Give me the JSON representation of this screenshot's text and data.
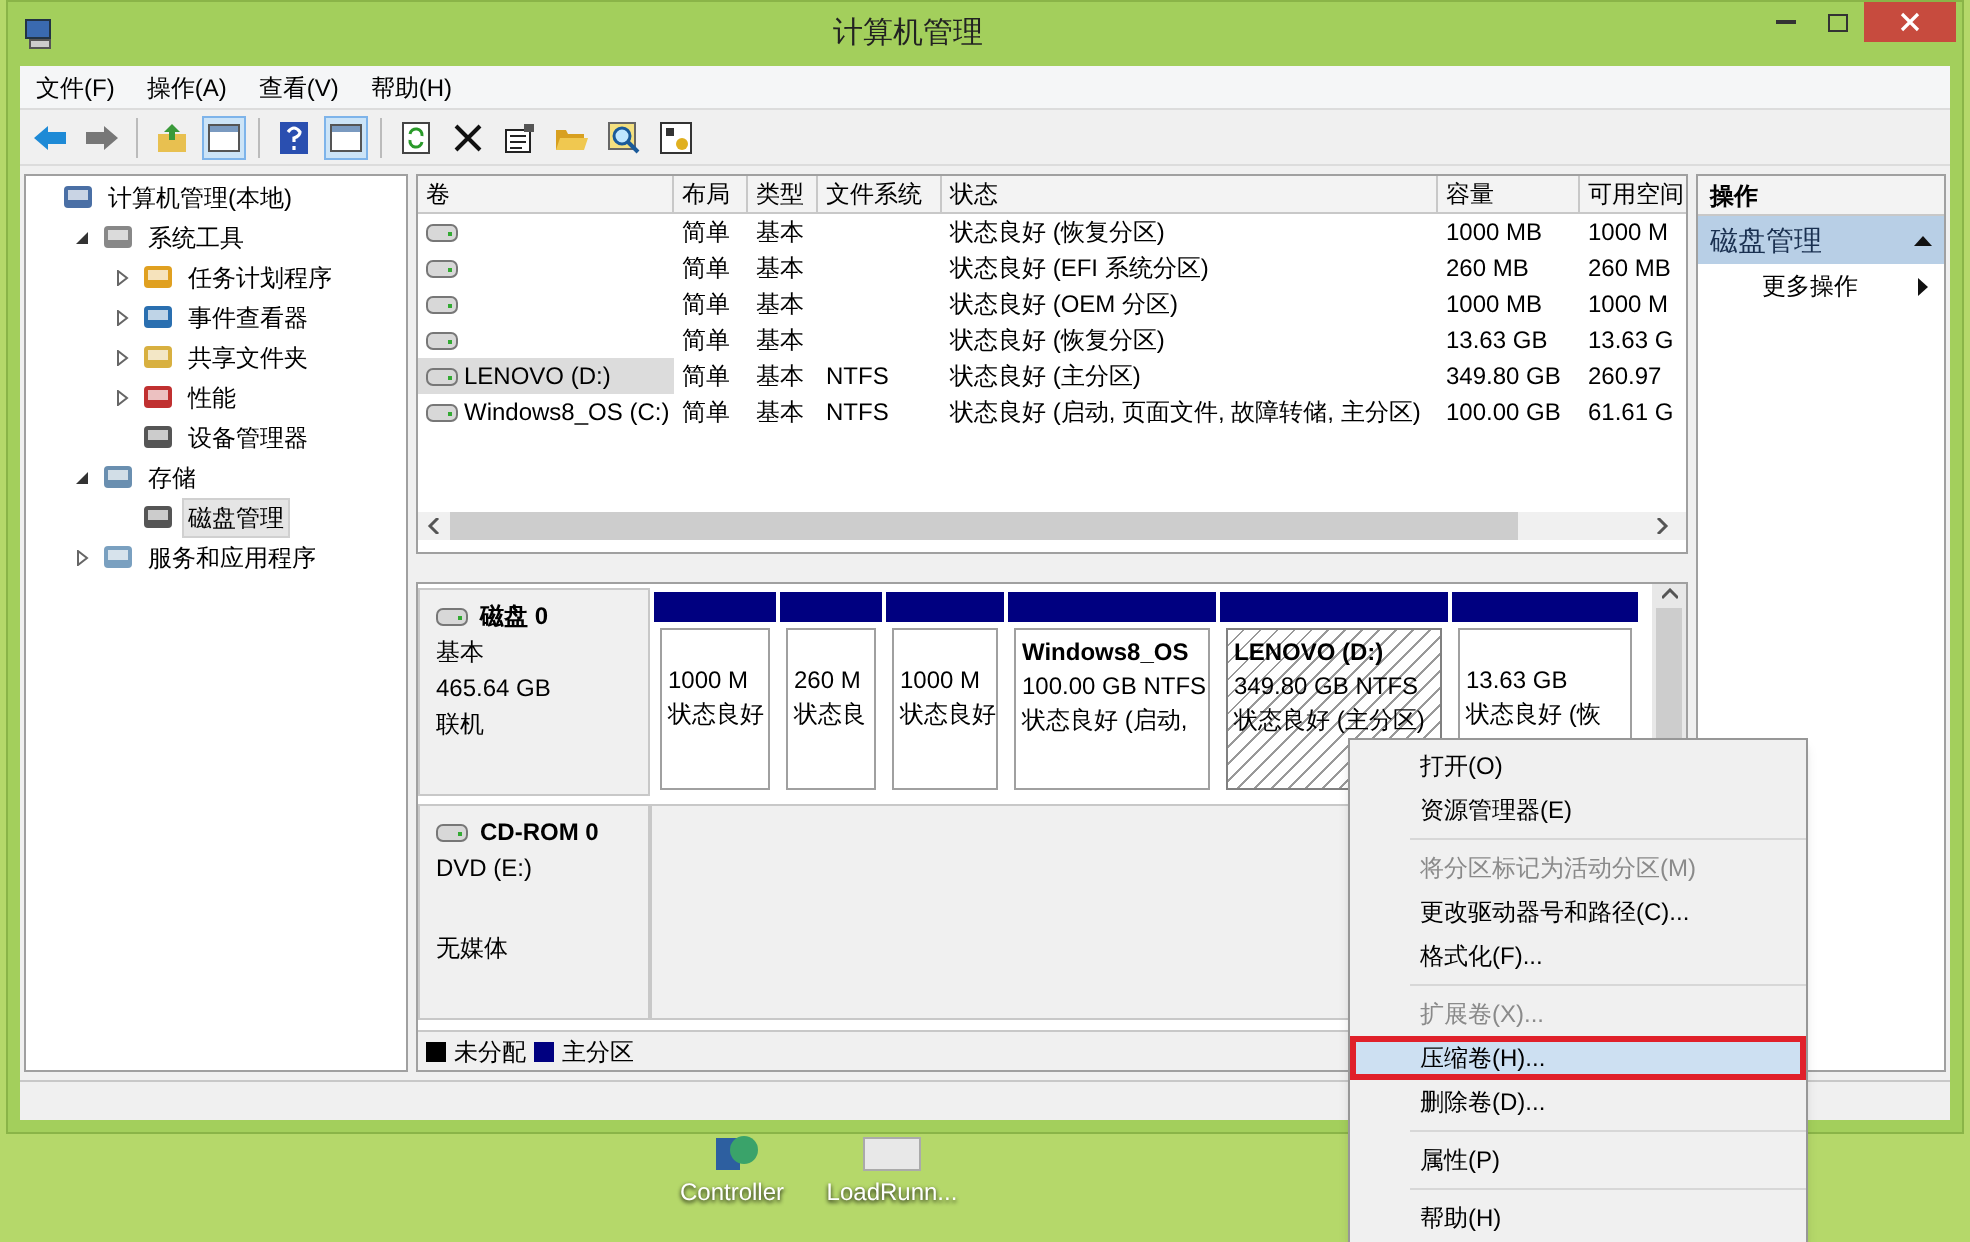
{
  "window": {
    "title": "计算机管理"
  },
  "menu": [
    "文件(F)",
    "操作(A)",
    "查看(V)",
    "帮助(H)"
  ],
  "toolbar": [
    {
      "kind": "button",
      "pressed": false
    },
    {
      "kind": "button",
      "pressed": false
    },
    {
      "kind": "separator"
    },
    {
      "kind": "button",
      "pressed": false
    },
    {
      "kind": "button",
      "pressed": true
    },
    {
      "kind": "separator"
    },
    {
      "kind": "button",
      "pressed": false
    },
    {
      "kind": "button",
      "pressed": true
    },
    {
      "kind": "separator"
    },
    {
      "kind": "button",
      "pressed": false
    },
    {
      "kind": "button",
      "pressed": false
    },
    {
      "kind": "button",
      "pressed": false
    },
    {
      "kind": "button",
      "pressed": false
    },
    {
      "kind": "button",
      "pressed": false
    },
    {
      "kind": "button",
      "pressed": false
    }
  ],
  "tree": [
    {
      "label": "计算机管理(本地)",
      "selected": false,
      "children": [
        {
          "label": "系统工具",
          "expanded": true,
          "selected": false,
          "children": [
            {
              "label": "任务计划程序",
              "expanded": false,
              "selected": false
            },
            {
              "label": "事件查看器",
              "expanded": false,
              "selected": false
            },
            {
              "label": "共享文件夹",
              "expanded": false,
              "selected": false
            },
            {
              "label": "性能",
              "expanded": false,
              "selected": false
            },
            {
              "label": "设备管理器",
              "selected": false
            }
          ]
        },
        {
          "label": "存储",
          "expanded": true,
          "selected": false,
          "children": [
            {
              "label": "磁盘管理",
              "selected": true
            }
          ]
        },
        {
          "label": "服务和应用程序",
          "expanded": false,
          "selected": false
        }
      ]
    }
  ],
  "table": {
    "columns": [
      "卷",
      "布局",
      "类型",
      "文件系统",
      "状态",
      "容量",
      "可用空间"
    ],
    "rows": [
      {
        "selected": false,
        "cells": [
          "",
          "简单",
          "基本",
          "",
          "状态良好 (恢复分区)",
          "1000 MB",
          "1000 M"
        ]
      },
      {
        "selected": false,
        "cells": [
          "",
          "简单",
          "基本",
          "",
          "状态良好 (EFI 系统分区)",
          "260 MB",
          "260 MB"
        ]
      },
      {
        "selected": false,
        "cells": [
          "",
          "简单",
          "基本",
          "",
          "状态良好 (OEM 分区)",
          "1000 MB",
          "1000 M"
        ]
      },
      {
        "selected": false,
        "cells": [
          "",
          "简单",
          "基本",
          "",
          "状态良好 (恢复分区)",
          "13.63 GB",
          "13.63 G"
        ]
      },
      {
        "selected": true,
        "cells": [
          "LENOVO (D:)",
          "简单",
          "基本",
          "NTFS",
          "状态良好 (主分区)",
          "349.80 GB",
          "260.97"
        ]
      },
      {
        "selected": false,
        "cells": [
          "Windows8_OS (C:)",
          "简单",
          "基本",
          "NTFS",
          "状态良好 (启动, 页面文件, 故障转储, 主分区)",
          "100.00 GB",
          "61.61 G"
        ]
      }
    ]
  },
  "disks": [
    {
      "name": "磁盘 0",
      "type": "基本",
      "size": "465.64 GB",
      "status": "联机",
      "partitions": [
        {
          "selected": false,
          "size": "1000 M",
          "status": "状态良好"
        },
        {
          "selected": false,
          "size": "260 M",
          "status": "状态良"
        },
        {
          "selected": false,
          "size": "1000 M",
          "status": "状态良好"
        },
        {
          "selected": false,
          "name": "Windows8_OS",
          "size": "100.00 GB NTFS",
          "status": "状态良好 (启动,"
        },
        {
          "selected": true,
          "name": "LENOVO  (D:)",
          "size": "349.80 GB NTFS",
          "status": "状态良好 (主分区)"
        },
        {
          "selected": false,
          "size": "13.63 GB",
          "status": "状态良好 (恢"
        }
      ]
    },
    {
      "name": "CD-ROM 0",
      "type": "DVD (E:)",
      "status": "无媒体"
    }
  ],
  "legend": [
    {
      "label": "未分配",
      "color": "#000000"
    },
    {
      "label": "主分区",
      "color": "#000080"
    }
  ],
  "actions": {
    "title": "操作",
    "section": "磁盘管理",
    "items": [
      "更多操作"
    ]
  },
  "context_menu": [
    {
      "kind": "item",
      "label": "打开(O)",
      "disabled": false,
      "selected": false
    },
    {
      "kind": "item",
      "label": "资源管理器(E)",
      "disabled": false,
      "selected": false
    },
    {
      "kind": "separator"
    },
    {
      "kind": "item",
      "label": "将分区标记为活动分区(M)",
      "disabled": true,
      "selected": false
    },
    {
      "kind": "item",
      "label": "更改驱动器号和路径(C)...",
      "disabled": false,
      "selected": false
    },
    {
      "kind": "item",
      "label": "格式化(F)...",
      "disabled": false,
      "selected": false
    },
    {
      "kind": "separator"
    },
    {
      "kind": "item",
      "label": "扩展卷(X)...",
      "disabled": true,
      "selected": false
    },
    {
      "kind": "item",
      "label": "压缩卷(H)...",
      "disabled": false,
      "selected": true
    },
    {
      "kind": "item",
      "label": "删除卷(D)...",
      "disabled": false,
      "selected": false
    },
    {
      "kind": "separator"
    },
    {
      "kind": "item",
      "label": "属性(P)",
      "disabled": false,
      "selected": false
    },
    {
      "kind": "separator"
    },
    {
      "kind": "item",
      "label": "帮助(H)",
      "disabled": false,
      "selected": false
    }
  ],
  "desktop_icons": [
    "Controller",
    "LoadRunn..."
  ]
}
